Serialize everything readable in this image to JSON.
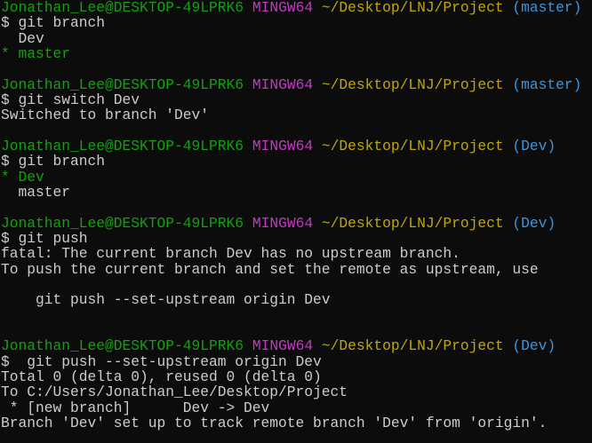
{
  "terminal": {
    "lines": [
      {
        "type": "prompt",
        "user": "Jonathan_Lee@DESKTOP-49LPRK6",
        "host": "MINGW64",
        "path": "~/Desktop/LNJ/Project",
        "branch": "(master)"
      },
      {
        "type": "command",
        "text": "$ git branch"
      },
      {
        "type": "output",
        "text": "  Dev"
      },
      {
        "type": "current",
        "text": "* master"
      },
      {
        "type": "blank",
        "text": ""
      },
      {
        "type": "prompt",
        "user": "Jonathan_Lee@DESKTOP-49LPRK6",
        "host": "MINGW64",
        "path": "~/Desktop/LNJ/Project",
        "branch": "(master)"
      },
      {
        "type": "command",
        "text": "$ git switch Dev"
      },
      {
        "type": "output",
        "text": "Switched to branch 'Dev'"
      },
      {
        "type": "blank",
        "text": ""
      },
      {
        "type": "prompt",
        "user": "Jonathan_Lee@DESKTOP-49LPRK6",
        "host": "MINGW64",
        "path": "~/Desktop/LNJ/Project",
        "branch": "(Dev)"
      },
      {
        "type": "command",
        "text": "$ git branch"
      },
      {
        "type": "current",
        "text": "* Dev"
      },
      {
        "type": "output",
        "text": "  master"
      },
      {
        "type": "blank",
        "text": ""
      },
      {
        "type": "prompt",
        "user": "Jonathan_Lee@DESKTOP-49LPRK6",
        "host": "MINGW64",
        "path": "~/Desktop/LNJ/Project",
        "branch": "(Dev)"
      },
      {
        "type": "command",
        "text": "$ git push"
      },
      {
        "type": "output",
        "text": "fatal: The current branch Dev has no upstream branch."
      },
      {
        "type": "output",
        "text": "To push the current branch and set the remote as upstream, use"
      },
      {
        "type": "blank",
        "text": ""
      },
      {
        "type": "output",
        "text": "    git push --set-upstream origin Dev"
      },
      {
        "type": "blank",
        "text": ""
      },
      {
        "type": "blank",
        "text": ""
      },
      {
        "type": "prompt",
        "user": "Jonathan_Lee@DESKTOP-49LPRK6",
        "host": "MINGW64",
        "path": "~/Desktop/LNJ/Project",
        "branch": "(Dev)"
      },
      {
        "type": "command",
        "text": "$  git push --set-upstream origin Dev"
      },
      {
        "type": "output",
        "text": "Total 0 (delta 0), reused 0 (delta 0)"
      },
      {
        "type": "output",
        "text": "To C:/Users/Jonathan_Lee/Desktop/Project"
      },
      {
        "type": "output",
        "text": " * [new branch]      Dev -> Dev"
      },
      {
        "type": "output",
        "text": "Branch 'Dev' set up to track remote branch 'Dev' from 'origin'."
      }
    ]
  },
  "colors": {
    "background": "#0c0c0c",
    "text": "#cccccc",
    "user": "#13a10e",
    "host": "#c239c2",
    "path": "#c1a800",
    "branch": "#3a96dd"
  }
}
